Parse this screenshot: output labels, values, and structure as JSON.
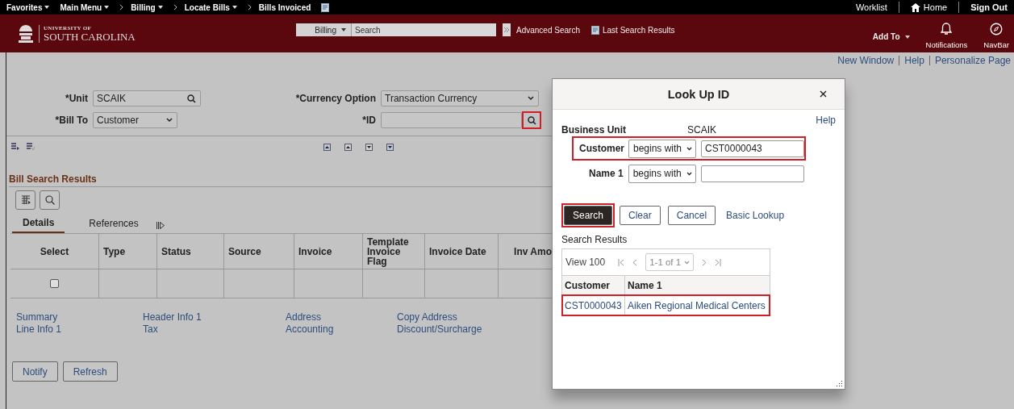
{
  "top_bar": {
    "nav": [
      {
        "label": "Favorites",
        "dropdown": true
      },
      {
        "label": "Main Menu",
        "dropdown": true
      }
    ],
    "breadcrumbs": [
      {
        "label": "Billing",
        "dropdown": true
      },
      {
        "label": "Locate Bills",
        "dropdown": true
      },
      {
        "label": "Bills Invoiced",
        "dropdown": false
      }
    ],
    "links": [
      "Worklist",
      "Home",
      "Sign Out"
    ]
  },
  "header": {
    "logo_small": "UNIVERSITY OF",
    "logo_large": "SOUTH CAROLINA",
    "search_scope": "Billing",
    "search_placeholder": "Search",
    "advanced_search": "Advanced Search",
    "last_search_results": "Last Search Results",
    "add_to": "Add To",
    "notifications": "Notifications",
    "navbar": "NavBar"
  },
  "page_links": [
    "New Window",
    "Help",
    "Personalize Page"
  ],
  "form": {
    "unit": {
      "label": "*Unit",
      "value": "SCAIK"
    },
    "bill_to": {
      "label": "*Bill To",
      "value": "Customer"
    },
    "currency_option": {
      "label": "*Currency Option",
      "value": "Transaction Currency"
    },
    "id": {
      "label": "*ID",
      "lookup_highlighted": true
    }
  },
  "results": {
    "title": "Bill Search Results",
    "tabs": [
      {
        "label": "Details",
        "selected": true
      },
      {
        "label": "References",
        "selected": false
      }
    ],
    "columns": [
      "Select",
      "Type",
      "Status",
      "Source",
      "Invoice",
      "Template Invoice Flag",
      "Invoice Date",
      "Inv Amo"
    ],
    "rows": [
      {
        "selected": false
      }
    ]
  },
  "link_columns": [
    [
      "Summary",
      "Line Info 1"
    ],
    [
      "Header Info 1",
      "Tax"
    ],
    [
      "Address",
      "Accounting"
    ],
    [
      "Copy Address",
      "Discount/Surcharge"
    ]
  ],
  "buttons": [
    "Notify",
    "Refresh"
  ],
  "lookup": {
    "title": "Look Up ID",
    "help": "Help",
    "business_unit_label": "Business Unit",
    "business_unit_value": "SCAIK",
    "criteria": [
      {
        "label": "Customer",
        "operator": "begins with",
        "value": "CST0000043",
        "highlighted": true
      },
      {
        "label": "Name 1",
        "operator": "begins with",
        "highlighted": false
      }
    ],
    "buttons": [
      {
        "label": "Search",
        "kind": "primary",
        "highlighted": true
      },
      {
        "label": "Clear",
        "kind": "secondary",
        "highlighted": false
      },
      {
        "label": "Cancel",
        "kind": "secondary",
        "highlighted": false
      },
      {
        "label": "Basic Lookup",
        "kind": "link",
        "highlighted": false
      }
    ],
    "results_title": "Search Results",
    "view": "View 100",
    "page": "1-1 of 1",
    "columns": [
      "Customer",
      "Name 1"
    ],
    "rows": [
      {
        "cells": [
          "CST0000043",
          "Aiken Regional Medical Centers"
        ],
        "highlighted": true
      }
    ]
  }
}
